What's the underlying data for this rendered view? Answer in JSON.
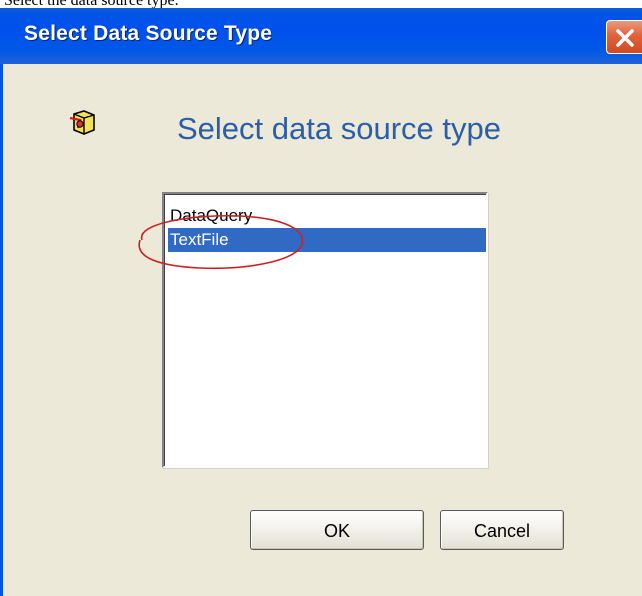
{
  "page_fragment": "Select the data source type.",
  "window": {
    "title": "Select Data Source Type"
  },
  "dialog": {
    "heading": "Select data source type",
    "icon": "data-source-icon"
  },
  "list": {
    "items": [
      {
        "label": "DataQuery",
        "selected": false
      },
      {
        "label": "TextFile",
        "selected": true
      }
    ],
    "selected_color": "#316ac5"
  },
  "buttons": {
    "ok_label": "OK",
    "cancel_label": "Cancel"
  },
  "colors": {
    "titlebar": "#0054e3",
    "dialog_bg": "#ece9d8",
    "heading": "#2a5ea8",
    "annotation": "#cc2222"
  }
}
